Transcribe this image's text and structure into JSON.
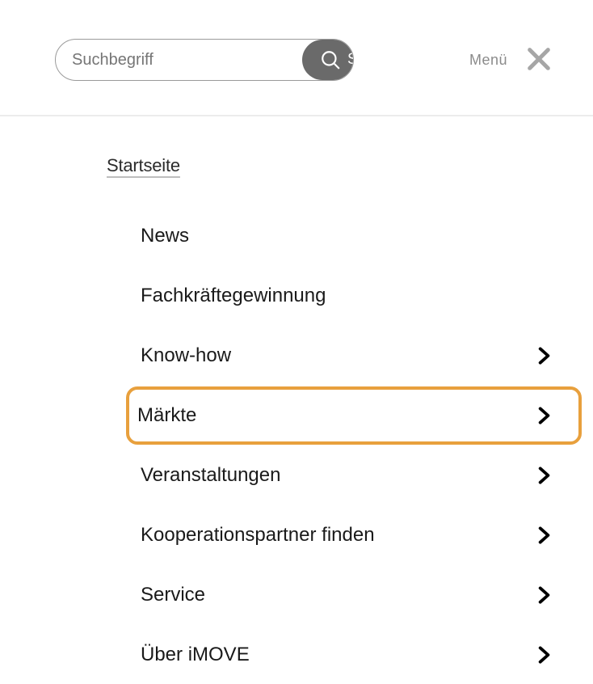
{
  "header": {
    "search_placeholder": "Suchbegriff",
    "search_button_label": "Suchen",
    "menu_label": "Menü"
  },
  "nav": {
    "breadcrumb": "Startseite",
    "items": [
      {
        "label": "News",
        "has_children": false,
        "highlighted": false
      },
      {
        "label": "Fachkräftegewinnung",
        "has_children": false,
        "highlighted": false
      },
      {
        "label": "Know-how",
        "has_children": true,
        "highlighted": false
      },
      {
        "label": "Märkte",
        "has_children": true,
        "highlighted": true
      },
      {
        "label": "Veranstaltungen",
        "has_children": true,
        "highlighted": false
      },
      {
        "label": "Kooperationspartner finden",
        "has_children": true,
        "highlighted": false
      },
      {
        "label": "Service",
        "has_children": true,
        "highlighted": false
      },
      {
        "label": "Über iMOVE",
        "has_children": true,
        "highlighted": false
      }
    ]
  }
}
